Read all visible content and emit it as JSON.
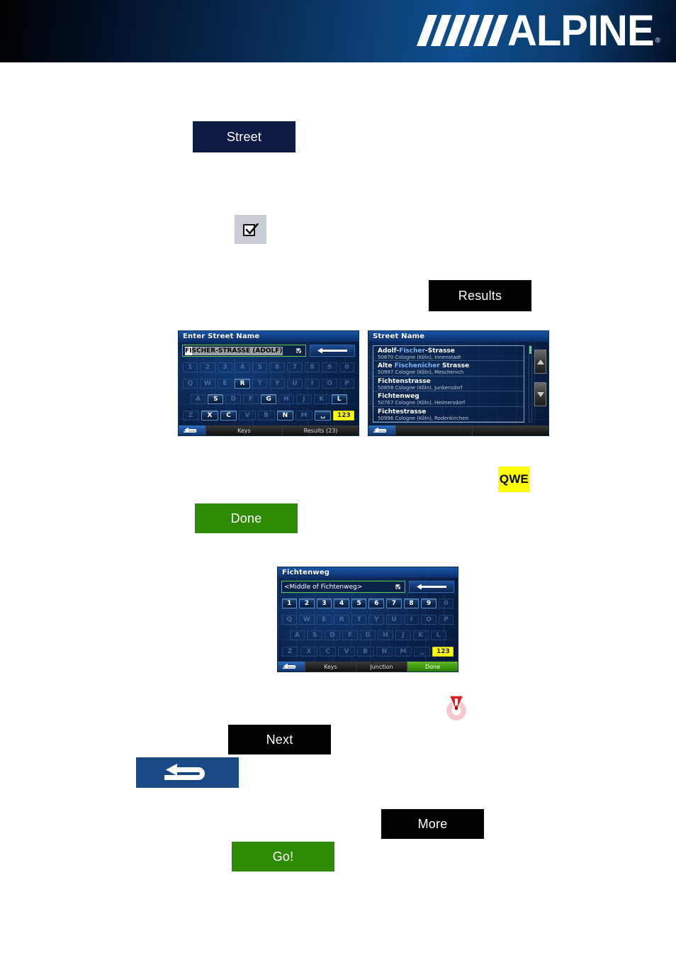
{
  "header": {
    "brand": "ALPINE",
    "registered_mark": "®"
  },
  "callouts": {
    "street": {
      "label": "Street"
    },
    "checkbox_icon": {
      "icon": "checkbox-checked-icon"
    },
    "results": {
      "label": "Results"
    },
    "qwe": {
      "label": "QWE"
    },
    "done": {
      "label": "Done"
    },
    "warning_icon": {
      "icon": "warning-exclamation-icon"
    },
    "next": {
      "label": "Next"
    },
    "back_icon": {
      "icon": "back-arrow-icon"
    },
    "more": {
      "label": "More"
    },
    "go": {
      "label": "Go!"
    }
  },
  "colors": {
    "navy": "#0d1b45",
    "black": "#000000",
    "green": "#2f8a06",
    "yellow": "#ffff00",
    "blue_box": "#1a4a85",
    "warning_red": "#e02020"
  },
  "screen_street_entry": {
    "title": "Enter Street Name",
    "input": {
      "typed": "FI",
      "suggestion": "SCHER-STRASSE (ADOLF)",
      "checkbox_icon": "checkbox-checked-icon"
    },
    "backspace_icon": "left-arrow-icon",
    "keyboard": {
      "row1": [
        "1",
        "2",
        "3",
        "4",
        "5",
        "6",
        "7",
        "8",
        "9",
        "0"
      ],
      "row2": [
        "Q",
        "W",
        "E",
        "R",
        "T",
        "Y",
        "U",
        "I",
        "O",
        "P"
      ],
      "row3": [
        "A",
        "S",
        "D",
        "F",
        "G",
        "H",
        "J",
        "K",
        "L"
      ],
      "row4": [
        "Z",
        "X",
        "C",
        "V",
        "B",
        "N",
        "M"
      ],
      "space_label": "␣",
      "numeric_toggle": "123",
      "active_keys": [
        "R",
        "S",
        "G",
        "L",
        "X",
        "C",
        "N"
      ]
    },
    "bottom_bar": {
      "back_icon": "back-arrow-icon",
      "keys_label": "Keys",
      "results_label": "Results (23)"
    }
  },
  "screen_street_results": {
    "title": "Street Name",
    "items": [
      {
        "name_pre": "Adolf-",
        "name_hl": "Fischer",
        "name_post": "-Strasse",
        "sub": "50670 Cologne (Köln), Innenstadt"
      },
      {
        "name_pre": "Alte ",
        "name_hl": "Fischenicher",
        "name_post": " Strasse",
        "sub": "50997 Cologne (Köln), Meschenich"
      },
      {
        "name_pre": "Fichtenstrasse",
        "name_hl": "",
        "name_post": "",
        "sub": "50858 Cologne (Köln), Junkersdorf"
      },
      {
        "name_pre": "Fichtenweg",
        "name_hl": "",
        "name_post": "",
        "sub": "50767 Cologne (Köln), Heimersdorf"
      },
      {
        "name_pre": "Fichtestrasse",
        "name_hl": "",
        "name_post": "",
        "sub": "50996 Cologne (Köln), Rodenkirchen"
      }
    ],
    "scroll_up_icon": "triangle-up-icon",
    "scroll_down_icon": "triangle-down-icon",
    "bottom_bar": {
      "back_icon": "back-arrow-icon"
    }
  },
  "screen_house_number": {
    "title": "Fichtenweg",
    "input": {
      "value": "<Middle of Fichtenweg>",
      "checkbox_icon": "checkbox-checked-icon"
    },
    "backspace_icon": "left-arrow-icon",
    "keyboard": {
      "row1": [
        "1",
        "2",
        "3",
        "4",
        "5",
        "6",
        "7",
        "8",
        "9",
        "0"
      ],
      "row2": [
        "Q",
        "W",
        "E",
        "R",
        "T",
        "Y",
        "U",
        "I",
        "O",
        "P"
      ],
      "row3": [
        "A",
        "S",
        "D",
        "F",
        "G",
        "H",
        "J",
        "K",
        "L"
      ],
      "row4": [
        "Z",
        "X",
        "C",
        "V",
        "B",
        "N",
        "M"
      ],
      "space_label": "␣",
      "numeric_toggle": "123",
      "active_keys": [
        "1",
        "2",
        "3",
        "4",
        "5",
        "6",
        "7",
        "8",
        "9"
      ]
    },
    "bottom_bar": {
      "back_icon": "back-arrow-icon",
      "keys_label": "Keys",
      "junction_label": "Junction",
      "done_label": "Done"
    }
  }
}
